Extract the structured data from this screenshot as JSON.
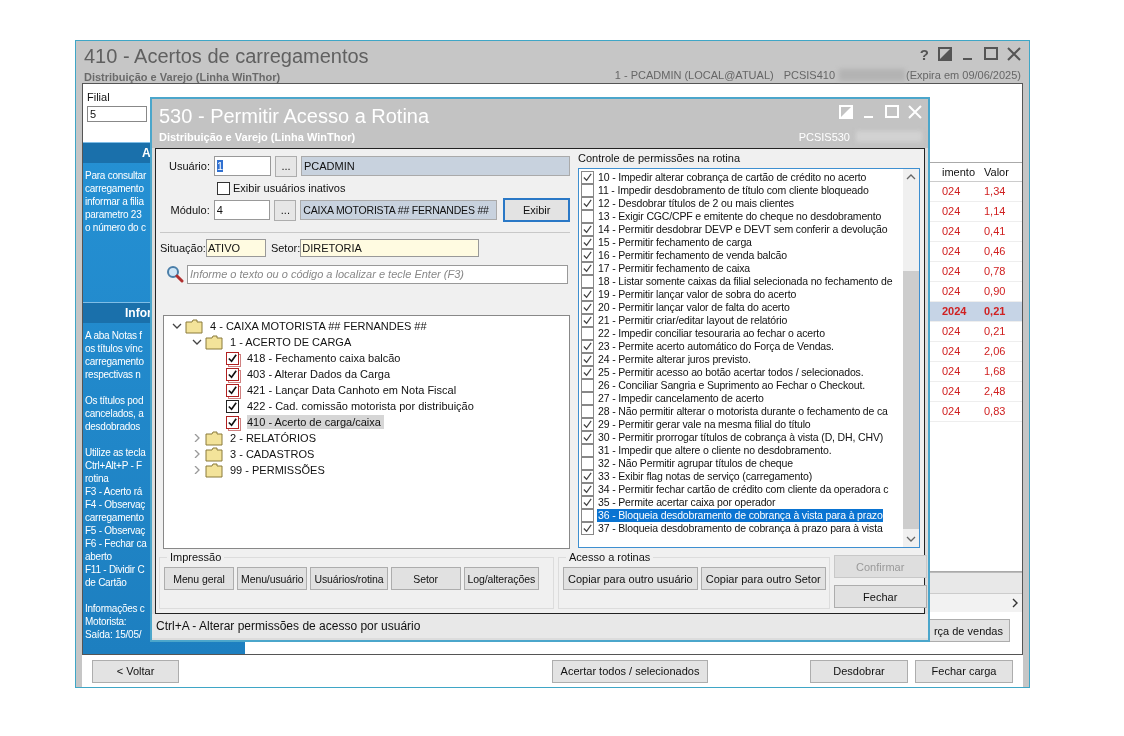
{
  "background_window": {
    "title": "410 - Acertos de carregamentos",
    "subtitle": "Distribuição e Varejo (Linha WinThor)",
    "help_glyph": "?",
    "user_info": "1 - PCADMIN (LOCAL@ATUAL)",
    "program_code": "PCSIS410",
    "expiry": "(Expira em 09/06/2025)",
    "filial": {
      "label": "Filial",
      "value": "5"
    },
    "info_panel": [
      {
        "heading": "A",
        "paragraphs": [
          [
            "Para consultar",
            "carregamento",
            "informar a filia",
            "parametro 23",
            "o número do c"
          ]
        ]
      },
      {
        "heading": "Infor",
        "paragraphs": [
          [
            "A aba Notas f",
            "os títulos vínc",
            "carregamento",
            "respectivas n"
          ],
          [
            "Os títulos pod",
            "cancelados, a",
            "desdobrados"
          ],
          [
            "Utilize as tecla",
            "Ctrl+Alt+P - F",
            "rotina",
            "F3 - Acerto rá",
            "F4 - Observaç",
            "carregamento",
            "F5 - Observaç",
            "F6 - Fechar ca",
            "aberto",
            "F11 - Dividir C",
            "de Cartão"
          ],
          [
            "Informações c",
            "Motorista:",
            "Saída: 15/05/"
          ]
        ]
      }
    ],
    "table": {
      "columns": [
        "imento",
        "Valor"
      ],
      "rows": [
        {
          "cells": [
            "024",
            "1,34"
          ],
          "selected": false
        },
        {
          "cells": [
            "024",
            "1,14"
          ],
          "selected": false
        },
        {
          "cells": [
            "024",
            "0,41"
          ],
          "selected": false
        },
        {
          "cells": [
            "024",
            "0,46"
          ],
          "selected": false
        },
        {
          "cells": [
            "024",
            "0,78"
          ],
          "selected": false
        },
        {
          "cells": [
            "024",
            "0,90"
          ],
          "selected": false
        },
        {
          "cells": [
            "2024",
            "0,21"
          ],
          "selected": true
        },
        {
          "cells": [
            "024",
            "0,21"
          ],
          "selected": false
        },
        {
          "cells": [
            "024",
            "2,06"
          ],
          "selected": false
        },
        {
          "cells": [
            "024",
            "1,68"
          ],
          "selected": false
        },
        {
          "cells": [
            "024",
            "2,48"
          ],
          "selected": false
        },
        {
          "cells": [
            "024",
            "0,83"
          ],
          "selected": false
        }
      ]
    },
    "partial_button": "rça de vendas",
    "footer": {
      "left": [
        "< Voltar"
      ],
      "center": [
        "Acertar todos / selecionados"
      ],
      "right": [
        "Desdobrar",
        "Fechar carga"
      ]
    }
  },
  "dialog": {
    "title": "530 - Permitir Acesso a Rotina",
    "subtitle": "Distribuição e Varejo (Linha WinThor)",
    "program_code": "PCSIS530",
    "user": {
      "label": "Usuário:",
      "code": "1",
      "lookup": "...",
      "name": "PCADMIN"
    },
    "show_inactive": {
      "label": "Exibir usuários inativos",
      "checked": false
    },
    "module": {
      "label": "Módulo:",
      "code": "4",
      "lookup": "...",
      "name": "CAIXA MOTORISTA ## FERNANDES ##"
    },
    "show_button": "Exibir",
    "situation": {
      "label": "Situação:",
      "value": "ATIVO"
    },
    "sector": {
      "label": "Setor:",
      "value": "DIRETORIA"
    },
    "search": {
      "placeholder": "Informe o texto ou o código a localizar e tecle Enter (F3)"
    },
    "tree": [
      {
        "kind": "folder",
        "label": "4 - CAIXA MOTORISTA ## FERNANDES ##",
        "expanded": true,
        "children": [
          {
            "kind": "folder",
            "label": "1 - ACERTO DE CARGA",
            "expanded": true,
            "children": [
              {
                "kind": "routine",
                "label": "418 - Fechamento caixa balcão",
                "checked": true,
                "changed": true,
                "selected": false
              },
              {
                "kind": "routine",
                "label": "403 - Alterar Dados da Carga",
                "checked": true,
                "changed": true,
                "selected": false
              },
              {
                "kind": "routine",
                "label": "421 - Lançar Data Canhoto em Nota Fiscal",
                "checked": true,
                "changed": true,
                "selected": false
              },
              {
                "kind": "routine",
                "label": "422 - Cad. comissão motorista por distribuição",
                "checked": true,
                "changed": false,
                "selected": false
              },
              {
                "kind": "routine",
                "label": "410 - Acerto de carga/caixa",
                "checked": true,
                "changed": true,
                "selected": true
              }
            ]
          },
          {
            "kind": "folder",
            "label": "2 - RELATÓRIOS",
            "expanded": false
          },
          {
            "kind": "folder",
            "label": "3 - CADASTROS",
            "expanded": false
          },
          {
            "kind": "folder",
            "label": "99 - PERMISSÕES",
            "expanded": false
          }
        ]
      }
    ],
    "permissions": {
      "title": "Controle de permissões na rotina",
      "items": [
        {
          "label": "10 - Impedir alterar cobrança de cartão de crédito no acerto",
          "checked": true,
          "selected": false
        },
        {
          "label": "11 - Impedir desdobramento de título com cliente bloqueado",
          "checked": false,
          "selected": false
        },
        {
          "label": "12 - Desdobrar títulos de 2 ou mais clientes",
          "checked": true,
          "selected": false
        },
        {
          "label": "13 - Exigir CGC/CPF e emitente do cheque no desdobramento",
          "checked": false,
          "selected": false
        },
        {
          "label": "14 - Permitir desdobrar DEVP e DEVT sem conferir a devolução",
          "checked": true,
          "selected": false
        },
        {
          "label": "15 - Permitir fechamento de carga",
          "checked": true,
          "selected": false
        },
        {
          "label": "16 - Permitir fechamento de venda balcão",
          "checked": true,
          "selected": false
        },
        {
          "label": "17 - Permitir fechamento de caixa",
          "checked": true,
          "selected": false
        },
        {
          "label": "18 - Listar somente caixas da filial selecionada no fechamento de",
          "checked": false,
          "selected": false
        },
        {
          "label": "19 - Permitir lançar valor de sobra do acerto",
          "checked": true,
          "selected": false
        },
        {
          "label": "20 - Permitir lançar valor de falta do acerto",
          "checked": true,
          "selected": false
        },
        {
          "label": "21 - Permitir criar/editar layout de relatório",
          "checked": true,
          "selected": false
        },
        {
          "label": "22 - Impedir conciliar tesouraria ao fechar o acerto",
          "checked": false,
          "selected": false
        },
        {
          "label": "23 - Permite acerto automático do Força de Vendas.",
          "checked": true,
          "selected": false
        },
        {
          "label": "24 - Permite alterar juros previsto.",
          "checked": true,
          "selected": false
        },
        {
          "label": "25 - Permitir acesso ao botão acertar todos / selecionados.",
          "checked": true,
          "selected": false
        },
        {
          "label": "26 - Conciliar Sangria e Suprimento ao Fechar o Checkout.",
          "checked": false,
          "selected": false
        },
        {
          "label": "27 - Impedir cancelamento de acerto",
          "checked": false,
          "selected": false
        },
        {
          "label": "28 - Não permitir alterar o motorista durante o fechamento de ca",
          "checked": false,
          "selected": false
        },
        {
          "label": "29 - Permitir gerar vale na mesma filial do título",
          "checked": true,
          "selected": false
        },
        {
          "label": "30 - Permitir prorrogar títulos de cobrança à vista (D, DH, CHV)",
          "checked": true,
          "selected": false
        },
        {
          "label": "31 - Impedir que altere o cliente no desdobramento.",
          "checked": false,
          "selected": false
        },
        {
          "label": "32 - Não Permitir agrupar títulos de cheque",
          "checked": false,
          "selected": false
        },
        {
          "label": "33 - Exibir flag notas de serviço (carregamento)",
          "checked": true,
          "selected": false
        },
        {
          "label": "34 - Permitir fechar cartão de crédito com cliente da operadora c",
          "checked": true,
          "selected": false
        },
        {
          "label": "35 - Permite acertar caixa por operador",
          "checked": true,
          "selected": false
        },
        {
          "label": "36 - Bloqueia desdobramento de cobrança à vista para à prazo",
          "checked": false,
          "selected": true
        },
        {
          "label": "37 - Bloqueia desdobramento de cobrança à prazo para à vista",
          "checked": true,
          "selected": false
        }
      ]
    },
    "print_group": {
      "title": "Impressão",
      "buttons": [
        "Menu geral",
        "Menu/usuário",
        "Usuários/rotina",
        "Setor",
        "Log/alterações"
      ]
    },
    "access_group": {
      "title": "Acesso a rotinas",
      "buttons": [
        "Copiar para outro usuário",
        "Copiar para outro Setor"
      ]
    },
    "actions": [
      {
        "label": "Confirmar",
        "disabled": true
      },
      {
        "label": "Fechar",
        "disabled": false
      }
    ],
    "status_bar": "Ctrl+A - Alterar permissões de acesso por usuário"
  }
}
